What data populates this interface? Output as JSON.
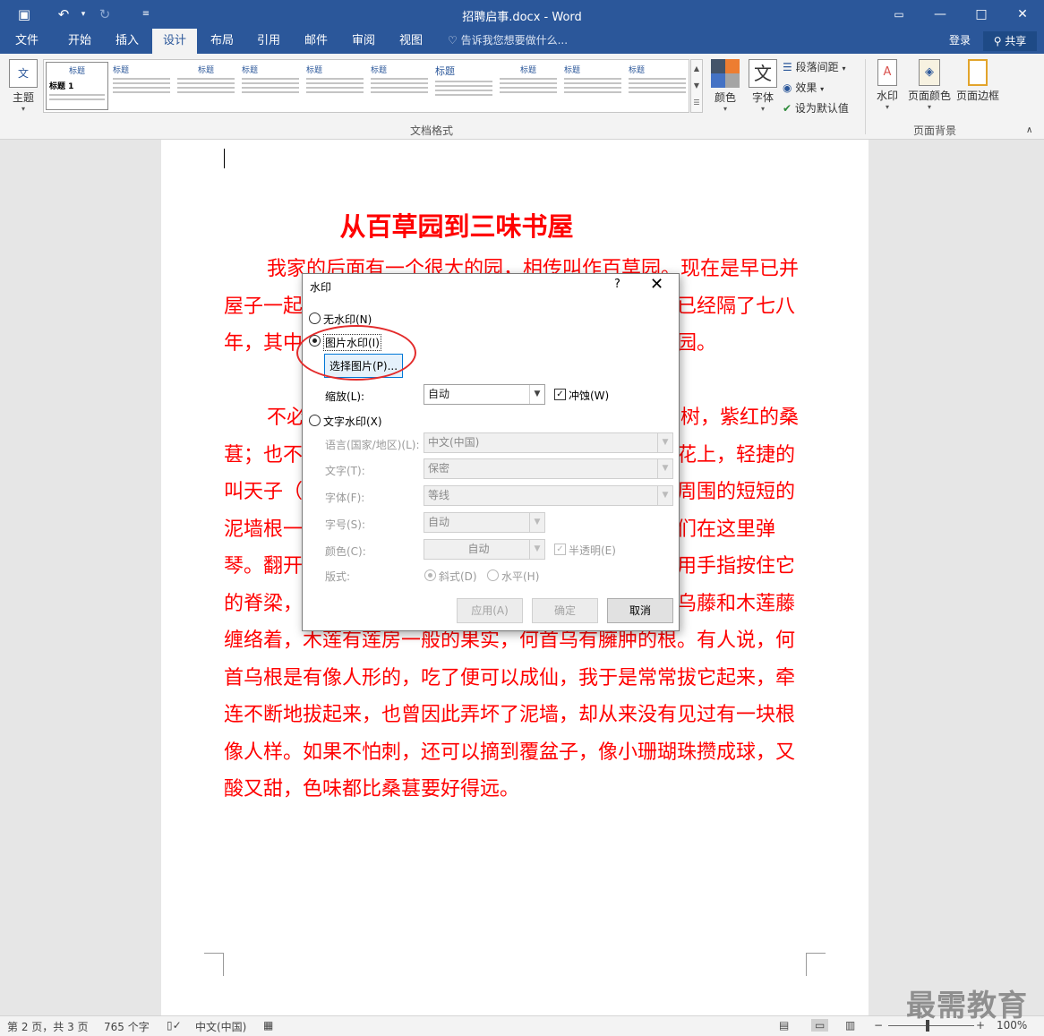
{
  "window": {
    "title": "招聘启事.docx - Word",
    "accent": "#2b579a"
  },
  "tabs": [
    "文件",
    "开始",
    "插入",
    "设计",
    "布局",
    "引用",
    "邮件",
    "审阅",
    "视图"
  ],
  "active_tab": "设计",
  "tell_me": "告诉我您想要做什么...",
  "account": {
    "login": "登录",
    "share": "共享"
  },
  "ribbon": {
    "theme_label": "主题",
    "styles": [
      {
        "title": "标题",
        "sub": "标题 1"
      },
      {
        "title": "标题",
        "sub": "标题 1"
      },
      {
        "title": "标题",
        "sub": "标题 1"
      },
      {
        "title": "标题",
        "sub": "标题 1"
      },
      {
        "title": "标题",
        "sub": "标题 1"
      },
      {
        "title": "标题",
        "sub": "标题 1"
      },
      {
        "title": "标题",
        "sub": "标题 1"
      },
      {
        "title": "标题",
        "sub": "标题 1"
      },
      {
        "title": "标题",
        "sub": "标题 1"
      },
      {
        "title": "标题",
        "sub": "标题 1"
      }
    ],
    "colors_label": "颜色",
    "fonts_label": "字体",
    "paragraph_spacing": "段落间距",
    "effects": "效果",
    "set_default": "设为默认值",
    "group_doc_format": "文档格式",
    "watermark": "水印",
    "page_color": "页面颜色",
    "page_border": "页面边框",
    "group_page_bg": "页面背景"
  },
  "document": {
    "heading": "从百草园到三味书屋",
    "text_color": "#ff0000",
    "paragraphs": [
      "我家的后面有一个很大的园，相传叫作百草园。现在是早已并屋子一起卖给朱文公的子孙了，连那最末次的相见也已经隔了七八年，其中似乎确凿只有一些野草；但那时却是我的乐园。",
      "不必说碧绿的菜畦，光滑的石井栏，高大的皂荚树，紫红的桑葚；也不必说鸣蝉在树叶里长吟，肥胖的黄蜂伏在菜花上，轻捷的叫天子（云雀）忽然从草间直窜向云霄里去了。单是周围的短短的泥墙根一带，就有无限趣味。油蛉在这里低唱，蟋蟀们在这里弹琴。翻开断砖来，有时会遇见蜈蚣；还有斑蝥，倘若用手指按住它的脊梁，便会啪的一声，从后窍喷出一阵烟雾。何首乌藤和木莲藤缠络着，木莲有莲房一般的果实，何首乌有臃肿的根。有人说，何首乌根是有像人形的，吃了便可以成仙，我于是常常拔它起来，牵连不断地拔起来，也曾因此弄坏了泥墙，却从来没有见过有一块根像人样。如果不怕刺，还可以摘到覆盆子，像小珊瑚珠攒成球，又酸又甜，色味都比桑葚要好得远。"
    ]
  },
  "dialog": {
    "title": "水印",
    "help": "?",
    "close": "✕",
    "no_watermark": "无水印(N)",
    "picture_watermark": "图片水印(I)",
    "select_picture": "选择图片(P)...",
    "scale_label": "缩放(L):",
    "scale_value": "自动",
    "washout": "冲蚀(W)",
    "text_watermark": "文字水印(X)",
    "language_label": "语言(国家/地区)(L):",
    "language_value": "中文(中国)",
    "text_label": "文字(T):",
    "text_value": "保密",
    "font_label": "字体(F):",
    "font_value": "等线",
    "size_label": "字号(S):",
    "size_value": "自动",
    "color_label": "颜色(C):",
    "color_value": "自动",
    "semitransparent": "半透明(E)",
    "layout_label": "版式:",
    "diagonal": "斜式(D)",
    "horizontal": "水平(H)",
    "apply": "应用(A)",
    "ok": "确定",
    "cancel": "取消"
  },
  "status": {
    "page": "第 2 页，共 3 页",
    "words": "765 个字",
    "language": "中文(中国)",
    "zoom": "100%"
  },
  "logo_text": "最需教育"
}
